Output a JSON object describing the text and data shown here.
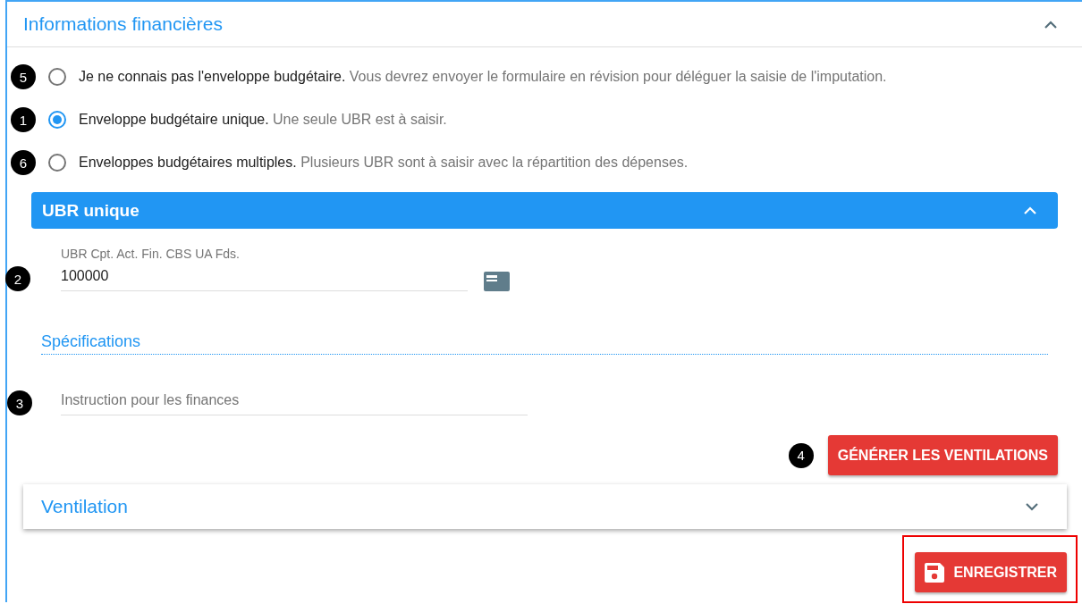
{
  "section": {
    "title": "Informations financières",
    "expanded": true
  },
  "options": [
    {
      "label": "Je ne connais pas l'enveloppe budgétaire.",
      "hint": "Vous devrez envoyer le formulaire en révision pour déléguer la saisie de l'imputation.",
      "selected": false,
      "marker": "5"
    },
    {
      "label": "Enveloppe budgétaire unique.",
      "hint": "Une seule UBR est à saisir.",
      "selected": true,
      "marker": "1"
    },
    {
      "label": "Enveloppes budgétaires multiples.",
      "hint": "Plusieurs UBR sont à saisir avec la répartition des dépenses.",
      "selected": false,
      "marker": "6"
    }
  ],
  "ubr": {
    "title": "UBR unique",
    "expanded": true,
    "field": {
      "label": "UBR Cpt. Act. Fin. CBS UA Fds.",
      "value": "100000",
      "marker": "2"
    }
  },
  "specifications": {
    "title": "Spécifications",
    "field": {
      "placeholder": "Instruction pour les finances",
      "marker": "3"
    }
  },
  "generate_button": {
    "label": "GÉNÉRER LES VENTILATIONS",
    "marker": "4"
  },
  "ventilation": {
    "title": "Ventilation",
    "expanded": false
  },
  "save_button": {
    "label": "ENREGISTRER",
    "highlighted": true
  }
}
